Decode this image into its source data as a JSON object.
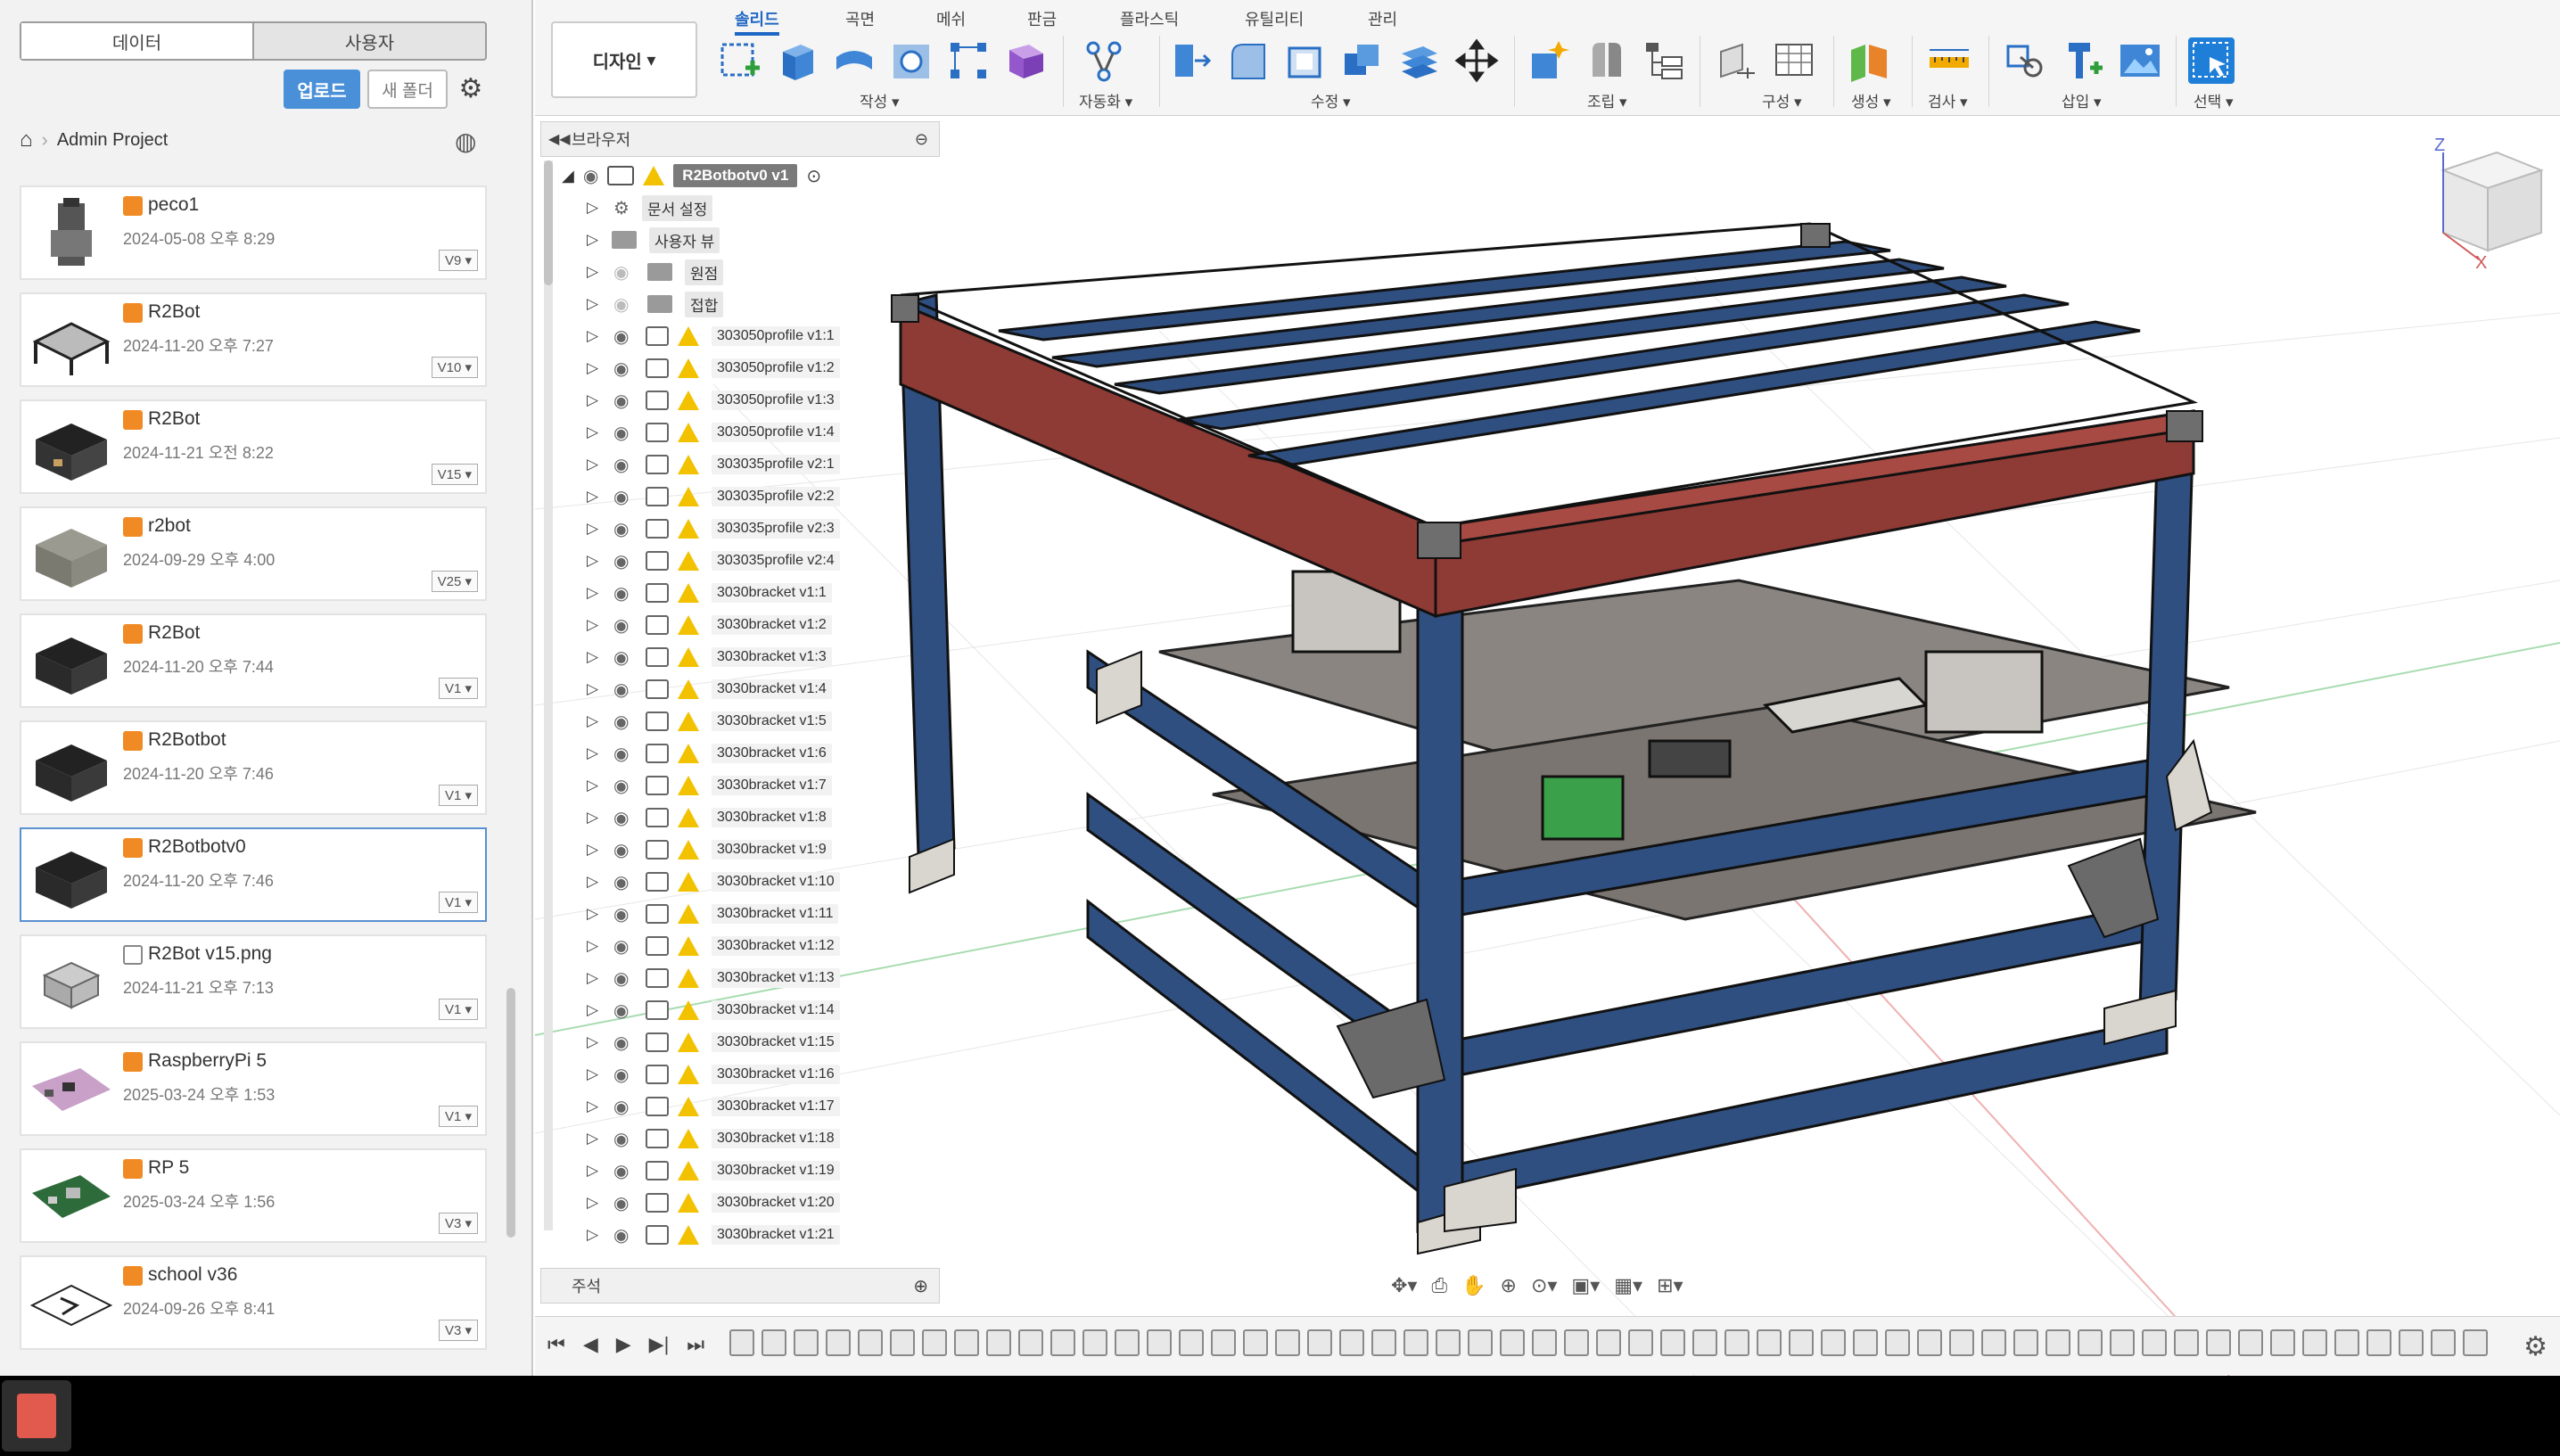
{
  "left_panel": {
    "tabs": [
      "데이터",
      "사용자"
    ],
    "upload_label": "업로드",
    "new_folder_label": "새 폴더",
    "breadcrumb": "Admin Project",
    "items": [
      {
        "name": "peco1",
        "date": "2024-05-08 오후 8:29",
        "version": "V9"
      },
      {
        "name": "R2Bot",
        "date": "2024-11-20 오후 7:27",
        "version": "V10"
      },
      {
        "name": "R2Bot",
        "date": "2024-11-21 오전 8:22",
        "version": "V15"
      },
      {
        "name": "r2bot",
        "date": "2024-09-29 오후 4:00",
        "version": "V25"
      },
      {
        "name": "R2Bot",
        "date": "2024-11-20 오후 7:44",
        "version": "V1"
      },
      {
        "name": "R2Botbot",
        "date": "2024-11-20 오후 7:46",
        "version": "V1"
      },
      {
        "name": "R2Botbotv0",
        "date": "2024-11-20 오후 7:46",
        "version": "V1"
      },
      {
        "name": "R2Bot v15.png",
        "date": "2024-11-21 오후 7:13",
        "version": "V1"
      },
      {
        "name": "RaspberryPi 5",
        "date": "2025-03-24 오후 1:53",
        "version": "V1"
      },
      {
        "name": "RP 5",
        "date": "2025-03-24 오후 1:56",
        "version": "V3"
      },
      {
        "name": "school v36",
        "date": "2024-09-26 오후 8:41",
        "version": "V3"
      }
    ]
  },
  "toolbar": {
    "design_label": "디자인",
    "tabs": [
      "솔리드",
      "곡면",
      "메쉬",
      "판금",
      "플라스틱",
      "유틸리티",
      "관리"
    ],
    "groups": [
      "작성",
      "자동화",
      "수정",
      "조립",
      "구성",
      "생성",
      "검사",
      "삽입",
      "선택"
    ]
  },
  "browser": {
    "title": "브라우저",
    "root_label": "R2Botbotv0 v1",
    "folders": [
      "문서 설정",
      "사용자 뷰",
      "원점",
      "접합"
    ],
    "components": [
      "303050profile v1:1",
      "303050profile v1:2",
      "303050profile v1:3",
      "303050profile v1:4",
      "303035profile v2:1",
      "303035profile v2:2",
      "303035profile v2:3",
      "303035profile v2:4",
      "3030bracket v1:1",
      "3030bracket v1:2",
      "3030bracket v1:3",
      "3030bracket v1:4",
      "3030bracket v1:5",
      "3030bracket v1:6",
      "3030bracket v1:7",
      "3030bracket v1:8",
      "3030bracket v1:9",
      "3030bracket v1:10",
      "3030bracket v1:11",
      "3030bracket v1:12",
      "3030bracket v1:13",
      "3030bracket v1:14",
      "3030bracket v1:15",
      "3030bracket v1:16",
      "3030bracket v1:17",
      "3030bracket v1:18",
      "3030bracket v1:19",
      "3030bracket v1:20",
      "3030bracket v1:21"
    ],
    "comments_label": "주석"
  },
  "viewcube": {
    "axis_z": "Z",
    "axis_x": "X"
  },
  "colors": {
    "accent": "#1f67c4",
    "frame_blue": "#2f4f80",
    "frame_red": "#8e3a35",
    "bracket": "#d9d5cf",
    "warning": "#f2c200"
  }
}
